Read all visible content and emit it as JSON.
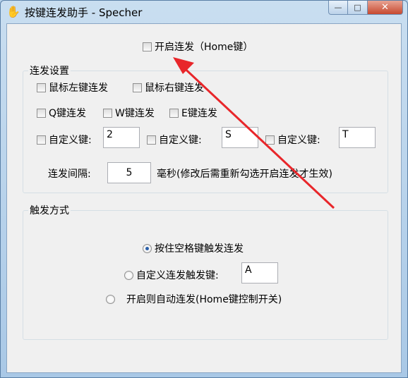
{
  "window": {
    "title": "按键连发助手 - Specher",
    "app_icon": "✋",
    "minimize_glyph": "—",
    "maximize_glyph": "□",
    "close_glyph": "✕"
  },
  "main_toggle": {
    "label": "开启连发（Home键）",
    "checked": false
  },
  "settings": {
    "group_label": "连发设置",
    "mouse_left": "鼠标左键连发",
    "mouse_right": "鼠标右键连发",
    "q_key": "Q键连发",
    "w_key": "W键连发",
    "e_key": "E键连发",
    "custom_key_label": "自定义键:",
    "custom1_value": "2",
    "custom2_value": "S",
    "custom3_value": "T",
    "interval_label": "连发间隔:",
    "interval_value": "5",
    "interval_note": "毫秒(修改后需重新勾选开启连发才生效)"
  },
  "trigger": {
    "group_label": "触发方式",
    "option_space": "按住空格键触发连发",
    "option_custom": "自定义连发触发键:",
    "custom_trigger_value": "A",
    "option_auto": "开启则自动连发(Home键控制开关)",
    "selected": "option_space"
  },
  "annotation": {
    "arrow_color": "#e8262a"
  }
}
